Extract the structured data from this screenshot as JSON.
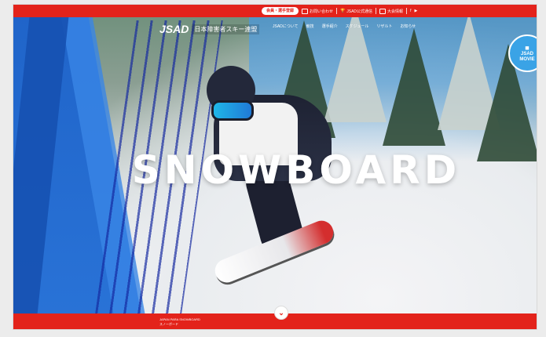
{
  "utility_bar": {
    "primary": "会員・選手登録",
    "items": [
      {
        "label": "お問い合わせ",
        "icon": "mail-icon"
      },
      {
        "label": "JSAD公式通信",
        "icon": "trophy-icon"
      },
      {
        "label": "大会情報",
        "icon": "calendar-icon"
      }
    ],
    "social": [
      "f",
      "▶"
    ]
  },
  "logo": {
    "mark": "JSAD",
    "name": "日本障害者スキー連盟"
  },
  "nav": {
    "items": [
      "JSADについて",
      "競技",
      "選手紹介",
      "スケジュール",
      "リザルト",
      "お知らせ"
    ]
  },
  "badge": {
    "icon": "video-camera-icon",
    "line1": "JSAD",
    "line2": "MOVIE"
  },
  "hero": {
    "title": "SNOWBOARD"
  },
  "footer": {
    "line1": "JAPAN PARA SNOWBOARD",
    "line2": "スノーボード"
  },
  "scroll": {
    "icon": "chevron-down-icon",
    "glyph": "⌄"
  },
  "colors": {
    "accent": "#e3231b",
    "blue": "#1f63c8"
  }
}
